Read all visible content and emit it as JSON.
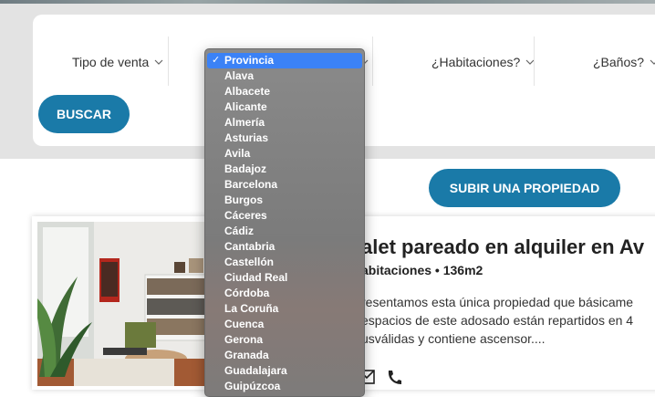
{
  "filters": {
    "tipo_venta": "Tipo de venta",
    "habitaciones": "¿Habitaciones?",
    "banos": "¿Baños?"
  },
  "buttons": {
    "buscar": "BUSCAR",
    "subir": "SUBIR UNA PROPIEDAD"
  },
  "dropdown": {
    "selected": "Provincia",
    "options": [
      "Alava",
      "Albacete",
      "Alicante",
      "Almería",
      "Asturias",
      "Avila",
      "Badajoz",
      "Barcelona",
      "Burgos",
      "Cáceres",
      "Cádiz",
      "Cantabria",
      "Castellón",
      "Ciudad Real",
      "Córdoba",
      "La Coruña",
      "Cuenca",
      "Gerona",
      "Granada",
      "Guadalajara",
      "Guipúzcoa"
    ]
  },
  "listing": {
    "title": "alet pareado en alquiler en Av",
    "specs": "abitaciones • 136m2",
    "description": [
      "resentamos esta única propiedad que básicame",
      "espacios de este adosado están repartidos en 4",
      "usválidas y contiene ascensor...."
    ]
  },
  "colors": {
    "accent": "#1a7aa8",
    "selection": "#3b82f6"
  }
}
